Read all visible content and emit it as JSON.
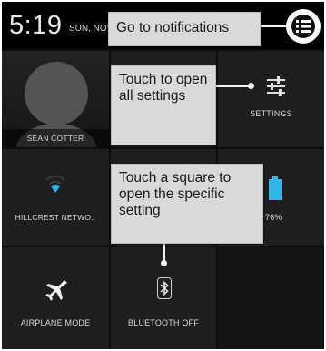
{
  "status_bar": {
    "time": "5:19",
    "date": "SUN, NOV"
  },
  "tiles": {
    "user_name": "SEAN COTTER",
    "settings_label": "SETTINGS",
    "wifi_label": "HILLCREST NETWO..",
    "battery_label": "76%",
    "battery_level_percent": 76,
    "airplane_label": "AIRPLANE MODE",
    "bluetooth_label": "BLUETOOTH OFF"
  },
  "callouts": {
    "notifications": "Go to notifications",
    "settings": "Touch to open all settings",
    "square": "Touch a square to open the specific setting"
  },
  "icons": {
    "notifications": "notifications-list-icon",
    "settings": "sliders-icon",
    "wifi": "wifi-icon",
    "battery": "battery-icon",
    "airplane": "airplane-icon",
    "bluetooth": "bluetooth-icon"
  },
  "colors": {
    "accent": "#33b5e5",
    "callout_bg": "#d9d9d9",
    "tile_bg": "#1e1e1e"
  }
}
